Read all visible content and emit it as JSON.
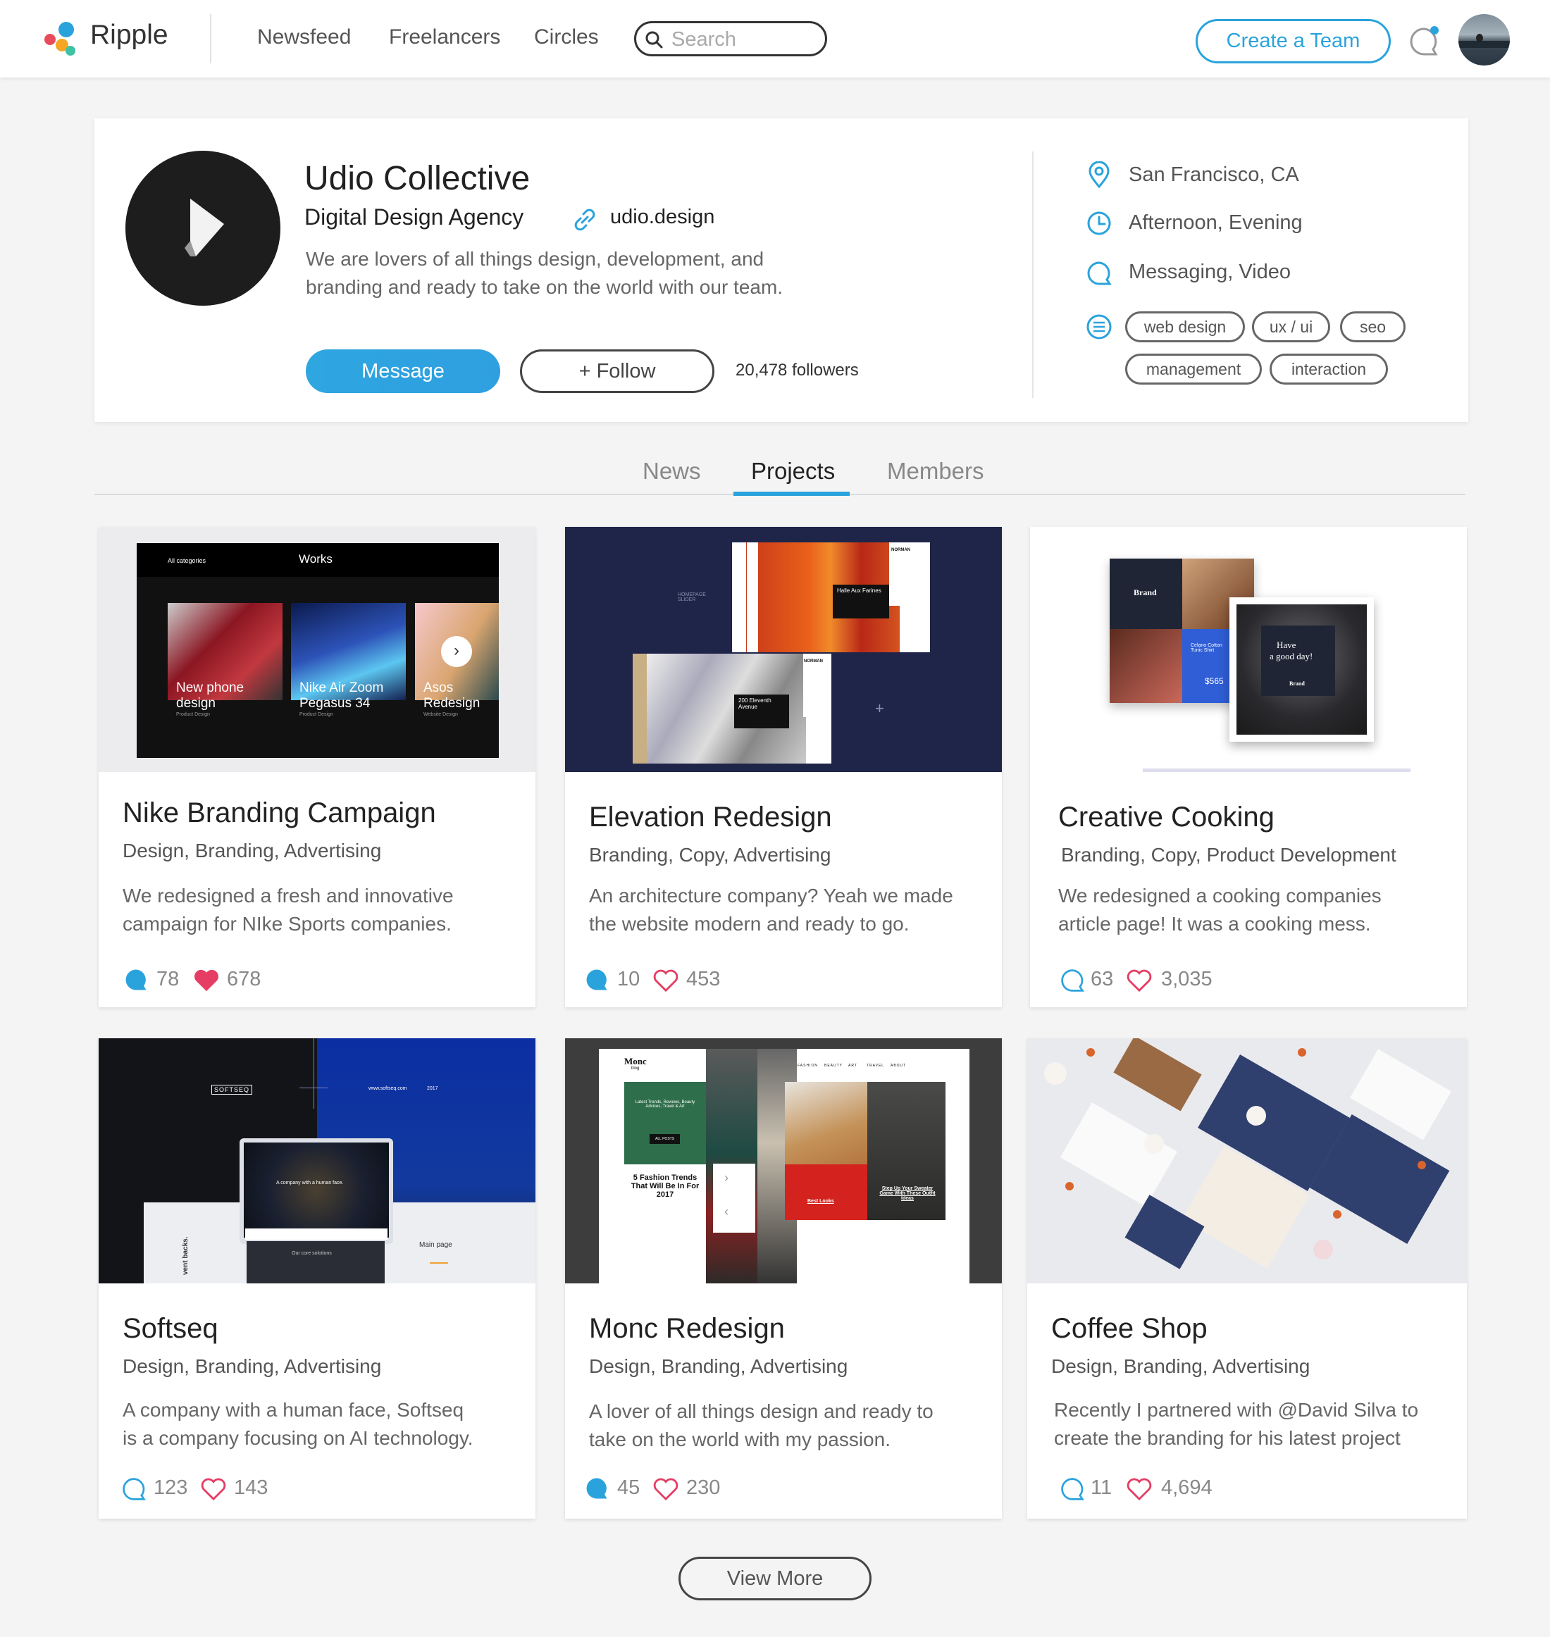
{
  "header": {
    "brand": "Ripple",
    "nav": [
      "Newsfeed",
      "Freelancers",
      "Circles"
    ],
    "search_placeholder": "Search",
    "create_team_label": "Create a Team"
  },
  "profile": {
    "name": "Udio Collective",
    "subtitle": "Digital Design Agency",
    "website": "udio.design",
    "description_line1": "We are lovers of all things design, development, and",
    "description_line2": "branding and ready to take on the world with our team.",
    "message_label": "Message",
    "follow_label": "+ Follow",
    "followers": "20,478 followers",
    "location": "San Francisco, CA",
    "availability": "Afternoon, Evening",
    "contact": "Messaging, Video",
    "tags": [
      "web design",
      "ux / ui",
      "seo",
      "management",
      "interaction"
    ]
  },
  "tabs": [
    "News",
    "Projects",
    "Members"
  ],
  "active_tab": "Projects",
  "projects": [
    {
      "title": "Nike Branding Campaign",
      "categories": "Design, Branding, Advertising",
      "desc1": "We redesigned a fresh and innovative",
      "desc2": "campaign for NIke Sports companies.",
      "comments": "78",
      "likes": "678",
      "thumb": {
        "all_categories": "All categories",
        "works": "Works",
        "item1": "New phone design",
        "item1_sub": "Product Design",
        "item2a": "Nike Air Zoom",
        "item2b": "Pegasus 34",
        "item2_sub": "Product Design",
        "item3a": "Asos",
        "item3b": "Redesign",
        "item3_sub": "Website Design"
      }
    },
    {
      "title": "Elevation Redesign",
      "categories": "Branding, Copy, Advertising",
      "desc1": "An architecture company? Yeah we made",
      "desc2": "the website modern and ready to go.",
      "comments": "10",
      "likes": "453",
      "thumb": {
        "slider_label": "HOMEPAGE SLIDER",
        "norman": "NORMAN",
        "caption1": "Halle Aux Farines",
        "caption2": "200 Eleventh Avenue"
      }
    },
    {
      "title": "Creative Cooking",
      "categories": "Branding, Copy, Product Development",
      "desc1": "We redesigned a cooking companies",
      "desc2": "article page! It was a cooking mess.",
      "comments": "63",
      "likes": "3,035",
      "thumb": {
        "brand": "Brand",
        "product": "Celano Cotton Tunic Shirt",
        "price": "$565",
        "good_day1": "Have",
        "good_day2": "a good day!",
        "brand2": "Brand"
      }
    },
    {
      "title": "Softseq",
      "categories": "Design, Branding, Advertising",
      "desc1": "A company with a human face, Softseq",
      "desc2": "is a company focusing on AI technology.",
      "comments": "123",
      "likes": "143",
      "thumb": {
        "logo": "SOFTSEQ",
        "url": "www.softseq.com",
        "year": "2017",
        "hero": "A company with a human face.",
        "main_page": "Main page",
        "core": "Our core solutions",
        "side": "vent backs."
      }
    },
    {
      "title": "Monc Redesign",
      "categories": "Design, Branding, Advertising",
      "desc1": "A lover of all things design and ready to",
      "desc2": "take on the world with my passion.",
      "comments": "45",
      "likes": "230",
      "thumb": {
        "logo": "Monc",
        "logo_sub": "blog",
        "menu": [
          "FASHION",
          "BEAUTY",
          "ART",
          "TRAVEL",
          "ABOUT"
        ],
        "latest": "Latest Trends, Reviews, Beauty Advices, Travel & Art",
        "all_posts": "ALL POSTS",
        "article": "5 Fashion Trends That Will Be In For 2017",
        "best_looks": "Best Looks",
        "sweater": "Step Up Your Sweater Game With These Outfit Ideas"
      }
    },
    {
      "title": "Coffee Shop",
      "categories": "Design, Branding, Advertising",
      "desc1": "Recently I partnered with @David Silva to",
      "desc2": "create the branding for his latest project",
      "comments": "11",
      "likes": "4,694",
      "thumb": {}
    }
  ],
  "view_more_label": "View More",
  "colors": {
    "accent": "#2aa3dc",
    "heart": "#e53d64",
    "logo_red": "#e84c5c",
    "logo_orange": "#f5a623",
    "logo_blue": "#2aa3dc"
  }
}
